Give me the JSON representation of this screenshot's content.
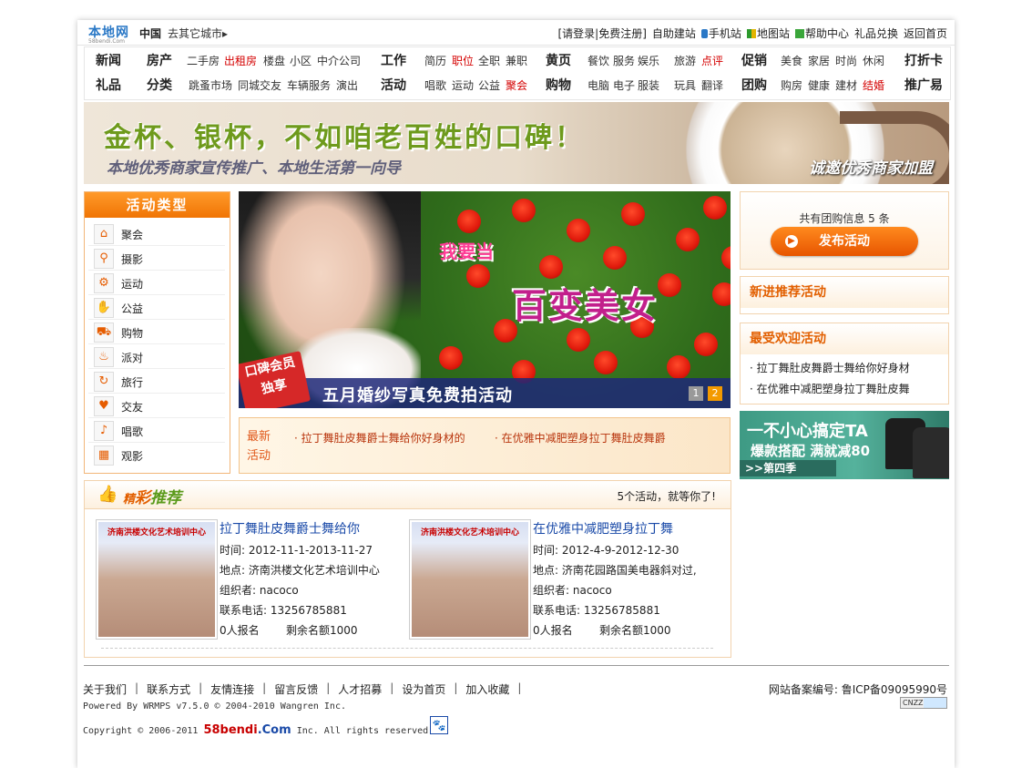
{
  "top": {
    "logo": "本地网",
    "logo_sub": "58bendi.Com",
    "city": "中国",
    "other_city": "去其它城市",
    "links": [
      "[请登录",
      "|免费注册]",
      "自助建站",
      "手机站",
      "地图站",
      "帮助中心",
      "礼品兑换",
      "返回首页"
    ]
  },
  "nav": {
    "row1": [
      {
        "t": "新闻",
        "h": true
      },
      {
        "t": "房产",
        "h": true
      },
      {
        "t": "二手房"
      },
      {
        "t": "出租房",
        "red": true
      },
      {
        "t": "楼盘"
      },
      {
        "t": "小区"
      },
      {
        "t": "中介公司"
      },
      {
        "t": "工作",
        "h": true
      },
      {
        "t": "简历"
      },
      {
        "t": "职位",
        "red": true
      },
      {
        "t": "全职"
      },
      {
        "t": "兼职"
      },
      {
        "t": "黄页",
        "h": true
      },
      {
        "t": "餐饮"
      },
      {
        "t": "服务"
      },
      {
        "t": "娱乐"
      },
      {
        "t": "旅游"
      },
      {
        "t": "点评",
        "red": true
      },
      {
        "t": "促销",
        "h": true
      },
      {
        "t": "美食"
      },
      {
        "t": "家居"
      },
      {
        "t": "时尚"
      },
      {
        "t": "休闲"
      },
      {
        "t": "打折卡",
        "h": true
      }
    ],
    "row2": [
      {
        "t": "礼品",
        "h": true
      },
      {
        "t": "分类",
        "h": true
      },
      {
        "t": "跳蚤市场"
      },
      {
        "t": "同城交友"
      },
      {
        "t": "车辆服务"
      },
      {
        "t": "演出"
      },
      {
        "t": "活动",
        "h": true
      },
      {
        "t": "唱歌"
      },
      {
        "t": "运动"
      },
      {
        "t": "公益"
      },
      {
        "t": "聚会",
        "red": true
      },
      {
        "t": "购物",
        "h": true
      },
      {
        "t": "电脑"
      },
      {
        "t": "电子"
      },
      {
        "t": "服装"
      },
      {
        "t": "玩具"
      },
      {
        "t": "翻译"
      },
      {
        "t": "团购",
        "h": true
      },
      {
        "t": "购房"
      },
      {
        "t": "健康"
      },
      {
        "t": "建材"
      },
      {
        "t": "结婚",
        "red": true
      },
      {
        "t": "推广易",
        "h": true
      }
    ]
  },
  "banner": {
    "headline": "金杯、银杯，不如咱老百姓的口碑！",
    "sub": "本地优秀商家宣传推广、本地生活第一向导",
    "cta": "诚邀优秀商家加盟"
  },
  "sidebar": {
    "title": "活动类型",
    "items": [
      {
        "label": "聚会",
        "icon": "home-icon"
      },
      {
        "label": "摄影",
        "icon": "magnifier-icon"
      },
      {
        "label": "运动",
        "icon": "bicycle-icon"
      },
      {
        "label": "公益",
        "icon": "thumbs-up-icon"
      },
      {
        "label": "购物",
        "icon": "cart-icon"
      },
      {
        "label": "派对",
        "icon": "cup-icon"
      },
      {
        "label": "旅行",
        "icon": "cycle-icon"
      },
      {
        "label": "交友",
        "icon": "hearts-icon"
      },
      {
        "label": "唱歌",
        "icon": "microphone-icon"
      },
      {
        "label": "观影",
        "icon": "film-icon"
      }
    ]
  },
  "slideshow": {
    "text1": "我要当",
    "text2": "百变美女",
    "caption": "五月婚纱写真免费拍活动",
    "badge_1": "口碑会员",
    "badge_2": "独享",
    "pages": [
      "1",
      "2"
    ],
    "active_page": "2"
  },
  "latest": {
    "label_1": "最新",
    "label_2": "活动",
    "items": [
      "· 拉丁舞肚皮舞爵士舞给你好身材的",
      "· 在优雅中减肥塑身拉丁舞肚皮舞爵"
    ]
  },
  "right": {
    "group_count": "共有团购信息 5 条",
    "publish": "发布活动",
    "new_title": "新进推荐活动",
    "popular_title": "最受欢迎活动",
    "popular": [
      "· 拉丁舞肚皮舞爵士舞给你好身材",
      "· 在优雅中减肥塑身拉丁舞肚皮舞"
    ],
    "ad": {
      "line1": "一不小心搞定TA",
      "line2": "爆款搭配  满就减80",
      "line3": ">>第四季"
    }
  },
  "recommend": {
    "title_a": "精",
    "title_b": "彩",
    "title_c": "推荐",
    "count_text": "5个活动，就等你了!",
    "cards": [
      {
        "img_caption": "济南洪楼文化艺术培训中心",
        "title": "拉丁舞肚皮舞爵士舞给你",
        "time": "时间: 2012-11-1-2013-11-27",
        "place": "地点: 济南洪楼文化艺术培训中心",
        "org": "组织者: nacoco",
        "phone": "联系电话: 13256785881",
        "signed": "0人报名",
        "left": "剩余名额1000"
      },
      {
        "img_caption": "济南洪楼文化艺术培训中心",
        "title": "在优雅中减肥塑身拉丁舞",
        "time": "时间: 2012-4-9-2012-12-30",
        "place": "地点: 济南花园路国美电器斜对过,",
        "org": "组织者: nacoco",
        "phone": "联系电话: 13256785881",
        "signed": "0人报名",
        "left": "剩余名额1000"
      }
    ]
  },
  "footer": {
    "links": [
      "关于我们",
      "联系方式",
      "友情连接",
      "留言反馈",
      "人才招募",
      "设为首页",
      "加入收藏"
    ],
    "icp": "网站备案编号: 鲁ICP备09095990号",
    "powered": "Powered By WRMPS v7.5.0 © 2004-2010 Wangren Inc.",
    "copy_pre": "Copyright © 2006-2011",
    "brand_a": "58bendi",
    "brand_b": ".Com",
    "copy_post": "Inc. All rights reserved.",
    "cnzz": "CNZZ"
  },
  "colors": {
    "accent": "#f07404",
    "red": "#d40000",
    "link": "#1a4aa8",
    "green": "#6e9a1c"
  }
}
